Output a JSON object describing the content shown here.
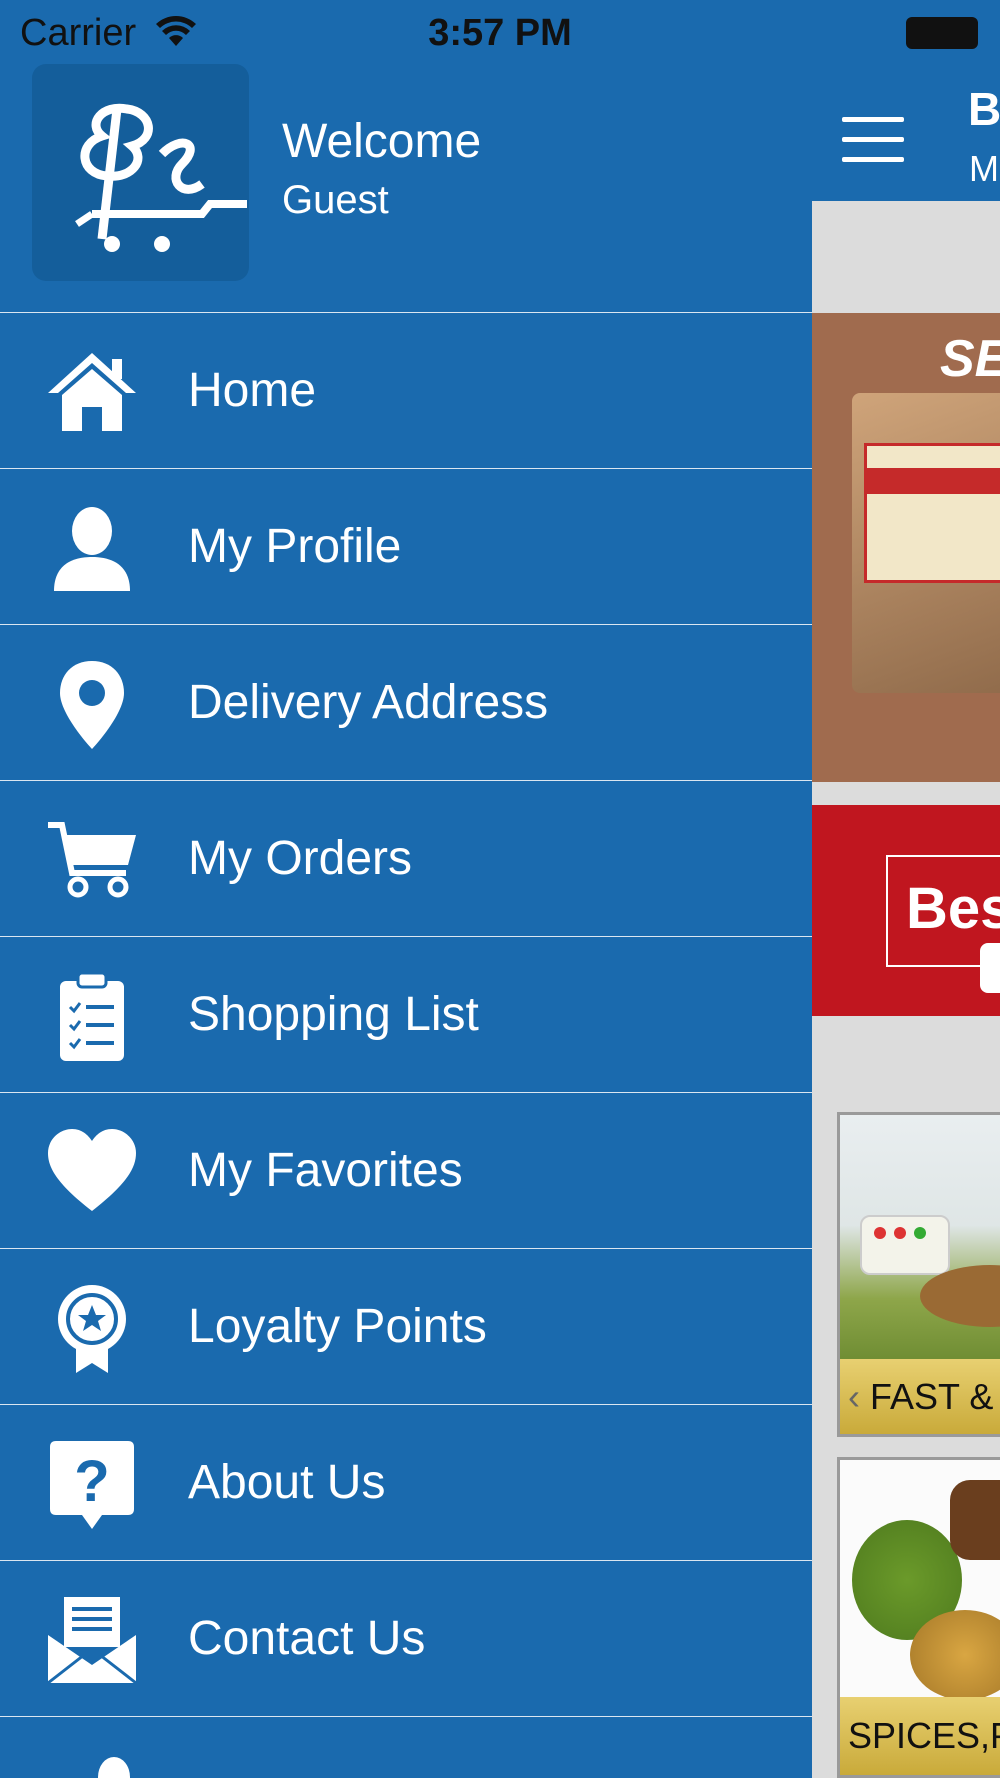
{
  "status_bar": {
    "carrier": "Carrier",
    "time": "3:57 PM"
  },
  "drawer": {
    "welcome": "Welcome",
    "user": "Guest",
    "menu": [
      {
        "label": "Home",
        "icon": "home-icon"
      },
      {
        "label": "My Profile",
        "icon": "user-icon"
      },
      {
        "label": "Delivery Address",
        "icon": "location-pin-icon"
      },
      {
        "label": "My Orders",
        "icon": "cart-icon"
      },
      {
        "label": "Shopping List",
        "icon": "clipboard-list-icon"
      },
      {
        "label": "My Favorites",
        "icon": "heart-icon"
      },
      {
        "label": "Loyalty Points",
        "icon": "award-badge-icon"
      },
      {
        "label": "About Us",
        "icon": "question-bubble-icon"
      },
      {
        "label": "Contact Us",
        "icon": "envelope-icon"
      }
    ]
  },
  "main": {
    "title": "B",
    "subtitle": "M",
    "banner_text": "SE",
    "promo_text": "Bes",
    "categories": [
      {
        "label": "FAST & "
      },
      {
        "label": "SPICES,P"
      }
    ]
  },
  "colors": {
    "primary": "#1a6aae",
    "promo_red": "#c0161f",
    "caption_gold": "#d8bc55"
  }
}
